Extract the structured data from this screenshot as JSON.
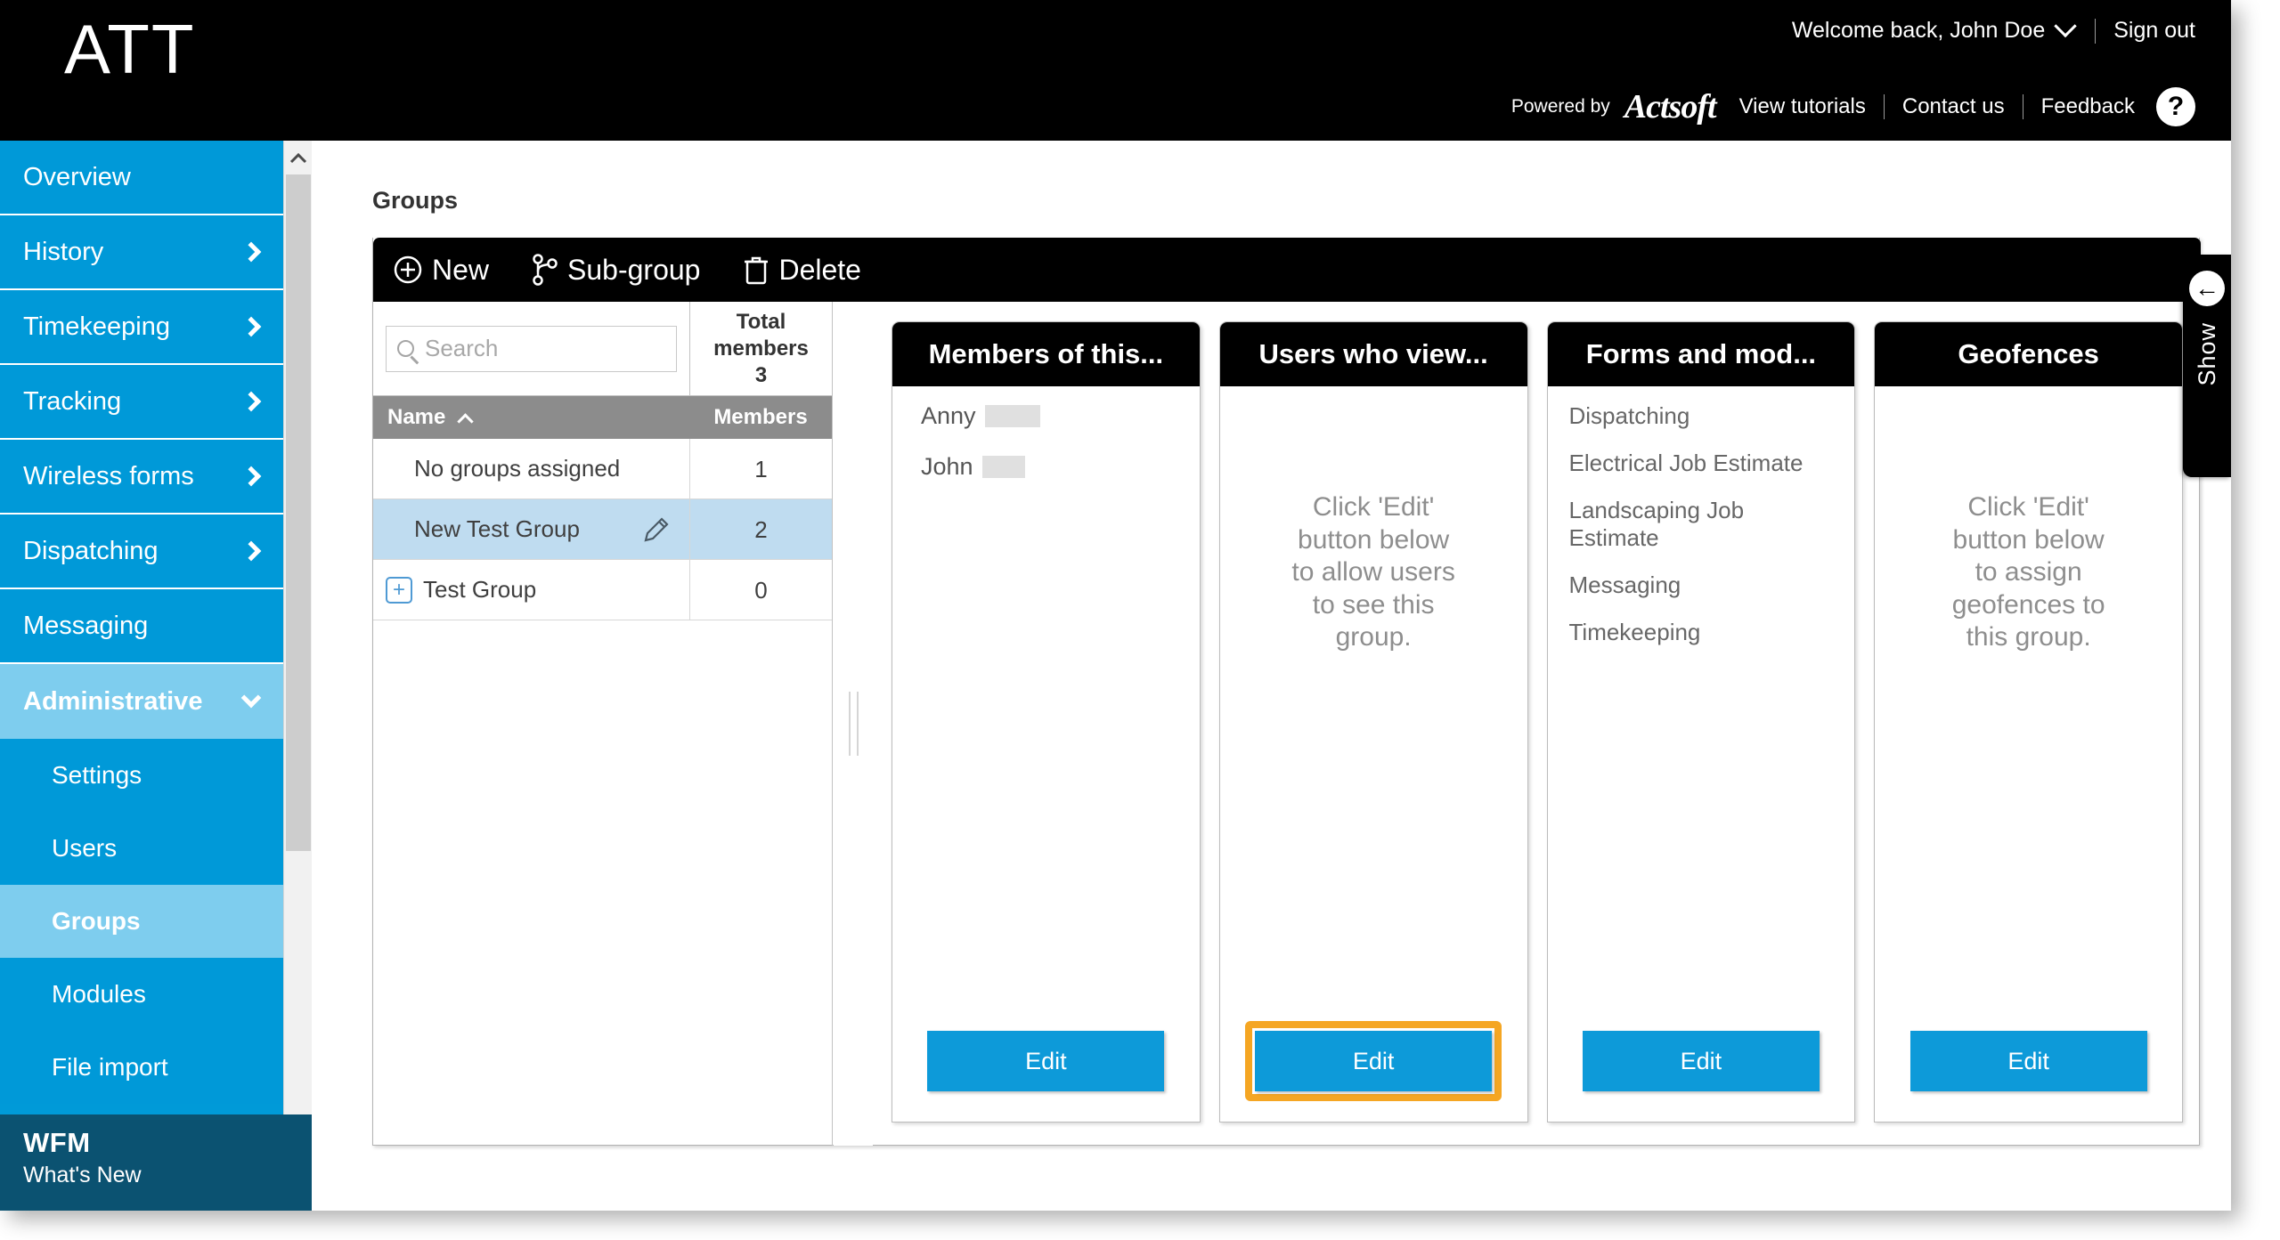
{
  "brand": {
    "logo_text": "ATT",
    "accent_blue": "#0099d8",
    "highlight_orange": "#f5a623",
    "dark_teal": "#0b5271"
  },
  "header": {
    "welcome": "Welcome back, John Doe",
    "sign_out": "Sign out",
    "powered_by": "Powered by",
    "actsoft": "Actsoft",
    "view_tutorials": "View tutorials",
    "contact_us": "Contact us",
    "feedback": "Feedback",
    "help": "?"
  },
  "sidebar": {
    "items": [
      {
        "label": "Overview",
        "expandable": false,
        "active": false
      },
      {
        "label": "History",
        "expandable": true,
        "active": false
      },
      {
        "label": "Timekeeping",
        "expandable": true,
        "active": false
      },
      {
        "label": "Tracking",
        "expandable": true,
        "active": false
      },
      {
        "label": "Wireless forms",
        "expandable": true,
        "active": false
      },
      {
        "label": "Dispatching",
        "expandable": true,
        "active": false
      },
      {
        "label": "Messaging",
        "expandable": false,
        "active": false
      },
      {
        "label": "Administrative",
        "expandable": true,
        "active": true,
        "expanded": true
      }
    ],
    "sub_items": [
      {
        "label": "Settings",
        "active": false
      },
      {
        "label": "Users",
        "active": false
      },
      {
        "label": "Groups",
        "active": true
      },
      {
        "label": "Modules",
        "active": false
      },
      {
        "label": "File import",
        "active": false
      }
    ],
    "footer": {
      "title": "WFM",
      "subtitle": "What's New"
    }
  },
  "main": {
    "page_title": "Groups",
    "toolbar": {
      "new_label": "New",
      "subgroup_label": "Sub-group",
      "delete_label": "Delete"
    },
    "search": {
      "placeholder": "Search",
      "value": ""
    },
    "totals": {
      "label_line1": "Total",
      "label_line2": "members",
      "count": "3"
    },
    "table": {
      "columns": [
        "Name",
        "Members"
      ],
      "sort_column": "Name",
      "sort_direction": "asc",
      "rows": [
        {
          "name": "No groups assigned",
          "members": "1",
          "selected": false,
          "expandable": false,
          "editable": false
        },
        {
          "name": "New Test Group",
          "members": "2",
          "selected": true,
          "expandable": false,
          "editable": true
        },
        {
          "name": "Test Group",
          "members": "0",
          "selected": false,
          "expandable": true,
          "editable": false
        }
      ]
    },
    "cards": [
      {
        "title": "Members of this...",
        "kind": "members",
        "members": [
          {
            "first": "Anny",
            "redacted_width": 62
          },
          {
            "first": "John",
            "redacted_width": 48
          }
        ],
        "hint": "",
        "edit_label": "Edit",
        "edit_highlighted": false
      },
      {
        "title": "Users who view...",
        "kind": "hint",
        "members": [],
        "hint": "Click 'Edit' button below to allow users to see this group.",
        "edit_label": "Edit",
        "edit_highlighted": true
      },
      {
        "title": "Forms and mod...",
        "kind": "list",
        "items": [
          "Dispatching",
          "Electrical Job Estimate",
          "Landscaping Job Estimate",
          "Messaging",
          "Timekeeping"
        ],
        "hint": "",
        "edit_label": "Edit",
        "edit_highlighted": false
      },
      {
        "title": "Geofences",
        "kind": "hint",
        "members": [],
        "hint": "Click 'Edit' button below to assign geofences to this group.",
        "edit_label": "Edit",
        "edit_highlighted": false
      }
    ]
  },
  "showtab": {
    "label": "Show",
    "arrow": "←"
  }
}
